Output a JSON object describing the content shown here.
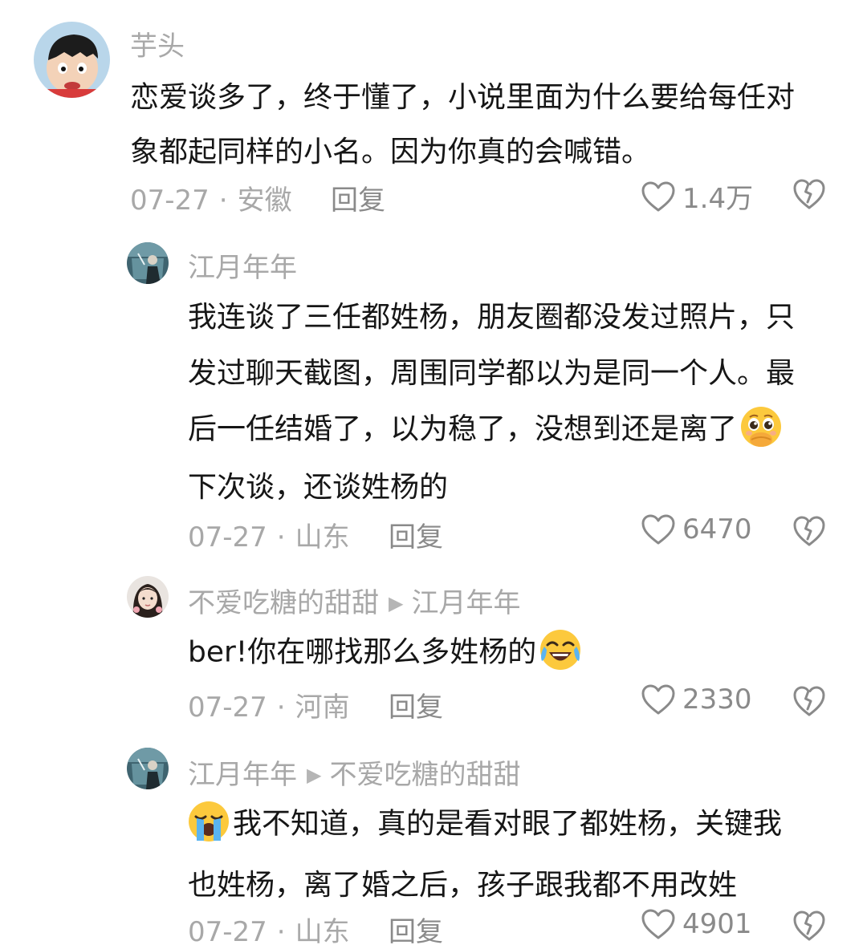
{
  "comments": [
    {
      "username": "芋头",
      "lines": [
        "恋爱谈多了，终于懂了，小说里面为什么要给每任对",
        "象都起同样的小名。因为你真的会喊错。"
      ],
      "date": "07-27",
      "location": "安徽",
      "reply_label": "回复",
      "likes": "1.4万"
    },
    {
      "username": "江月年年",
      "lines": [
        "我连谈了三任都姓杨，朋友圈都没发过照片，只",
        "发过聊天截图，周围同学都以为是同一个人。最",
        "后一任结婚了，以为稳了，没想到还是离了",
        "下次谈，还谈姓杨的"
      ],
      "emoji_line3": "pleading-face",
      "date": "07-27",
      "location": "山东",
      "reply_label": "回复",
      "likes": "6470"
    },
    {
      "username": "不爱吃糖的甜甜",
      "reply_to": "江月年年",
      "lines": [
        "ber!你在哪找那么多姓杨的"
      ],
      "emoji_line1": "crying-laughing-face",
      "date": "07-27",
      "location": "河南",
      "reply_label": "回复",
      "likes": "2330"
    },
    {
      "username": "江月年年",
      "reply_to": "不爱吃糖的甜甜",
      "lines": [
        "我不知道，真的是看对眼了都姓杨，关键我",
        "也姓杨，离了婚之后，孩子跟我都不用改姓"
      ],
      "emoji_lead": "loudly-crying-face",
      "date": "07-27",
      "location": "山东",
      "reply_label": "回复",
      "likes": "4901"
    }
  ],
  "separator": "·",
  "colors": {
    "username": "#a8a8a8",
    "text": "#161616",
    "meta": "#a8a8a8",
    "icon": "#8a8a8a"
  }
}
